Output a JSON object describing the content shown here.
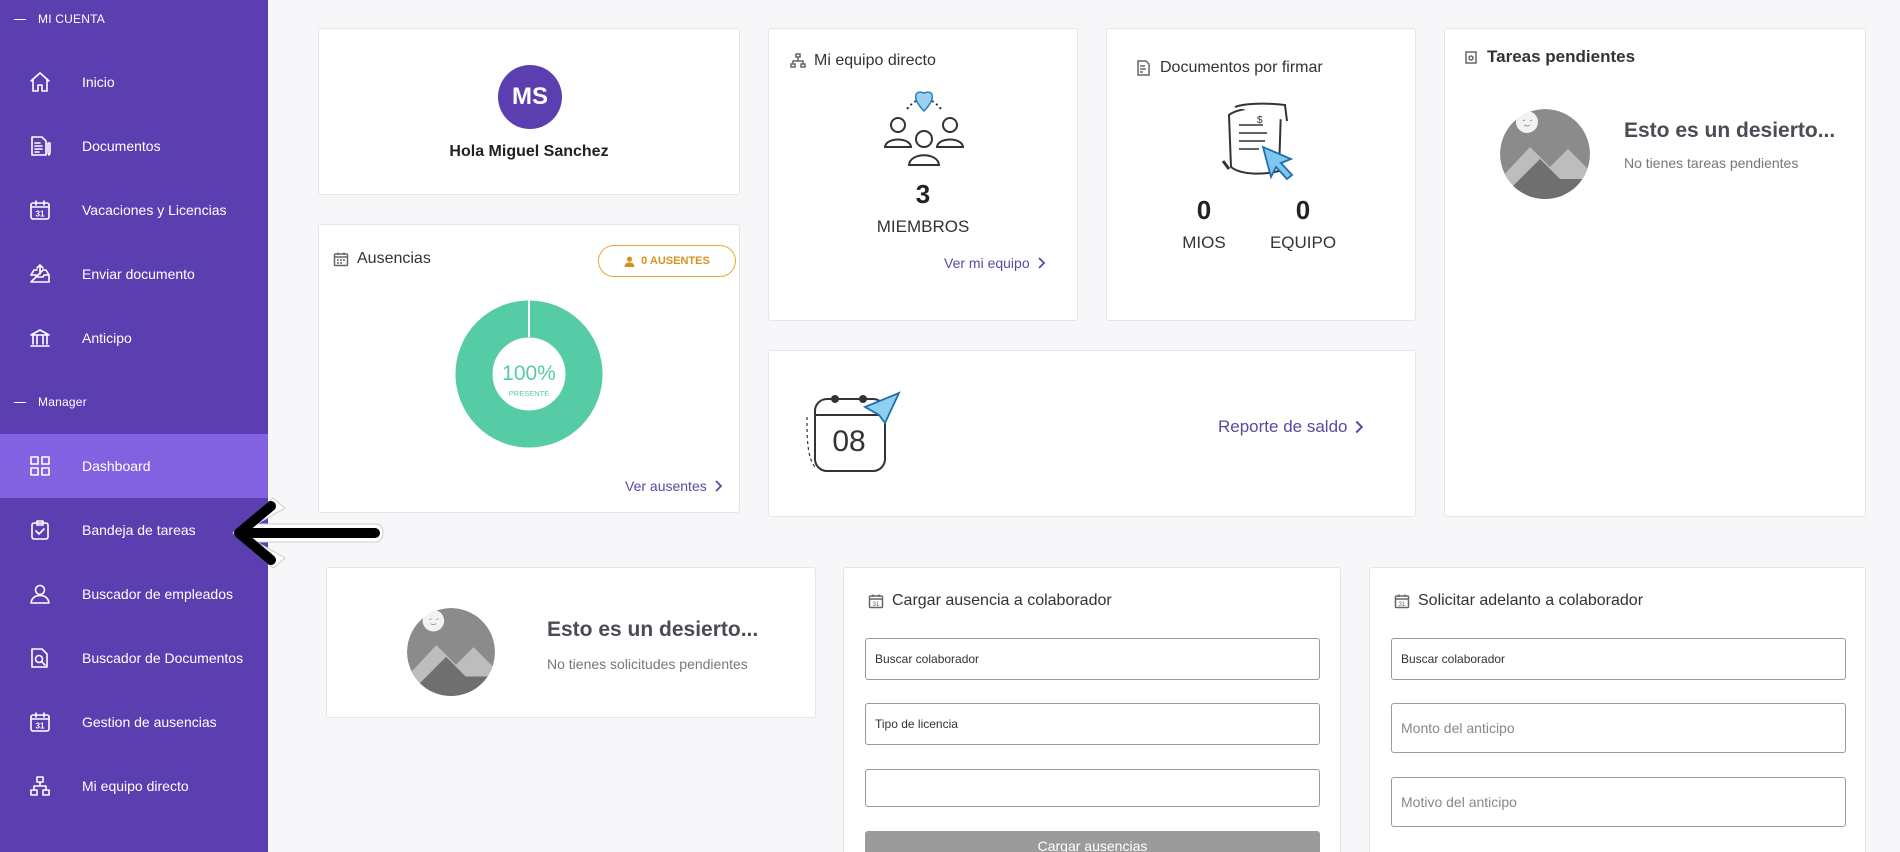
{
  "sidebar": {
    "section_account": "MI CUENTA",
    "section_manager": "Manager",
    "account_items": [
      {
        "label": "Inicio",
        "icon": "home-icon"
      },
      {
        "label": "Documentos",
        "icon": "documents-icon"
      },
      {
        "label": "Vacaciones y Licencias",
        "icon": "calendar-icon"
      },
      {
        "label": "Enviar documento",
        "icon": "inbox-send-icon"
      },
      {
        "label": "Anticipo",
        "icon": "bank-icon"
      }
    ],
    "manager_items": [
      {
        "label": "Dashboard",
        "icon": "dashboard-icon"
      },
      {
        "label": "Bandeja de tareas",
        "icon": "task-tray-icon"
      },
      {
        "label": "Buscador de empleados",
        "icon": "user-search-icon"
      },
      {
        "label": "Buscador de Documentos",
        "icon": "document-search-icon"
      },
      {
        "label": "Gestion de ausencias",
        "icon": "calendar-icon"
      },
      {
        "label": "Mi equipo directo",
        "icon": "org-chart-icon"
      }
    ],
    "active": "Dashboard"
  },
  "profile": {
    "initials": "MS",
    "greeting": "Hola Miguel Sanchez"
  },
  "team": {
    "title": "Mi equipo directo",
    "count": "3",
    "unit": "MIEMBROS",
    "link": "Ver mi equipo"
  },
  "docs": {
    "title": "Documentos por firmar",
    "mine_count": "0",
    "mine_label": "MIOS",
    "team_count": "0",
    "team_label": "EQUIPO"
  },
  "tasks": {
    "title": "Tareas pendientes",
    "empty_title": "Esto es un desierto...",
    "empty_sub": "No tienes tareas pendientes"
  },
  "absences": {
    "title": "Ausencias",
    "badge": "0 AUSENTES",
    "percent": "100%",
    "percent_label": "PRESENTE",
    "present_fraction": 1.0,
    "link": "Ver ausentes"
  },
  "report": {
    "link": "Reporte de saldo",
    "calendar_number": "08"
  },
  "requests": {
    "empty_title": "Esto es un desierto...",
    "empty_sub": "No tienes solicitudes pendientes"
  },
  "load_absence": {
    "title": "Cargar ausencia a colaborador",
    "field1": "Buscar colaborador",
    "field2": "Tipo de licencia",
    "field3": "",
    "button": "Cargar ausencias"
  },
  "advance": {
    "title": "Solicitar adelanto a colaborador",
    "field1": "Buscar colaborador",
    "field2_placeholder": "Monto del anticipo",
    "field3_placeholder": "Motivo del anticipo"
  },
  "colors": {
    "sidebar": "#5b3fb1",
    "sidebar_active": "#8262e0",
    "donut": "#55cba6",
    "badge": "#e5a93a",
    "link": "#5b4aa0"
  }
}
